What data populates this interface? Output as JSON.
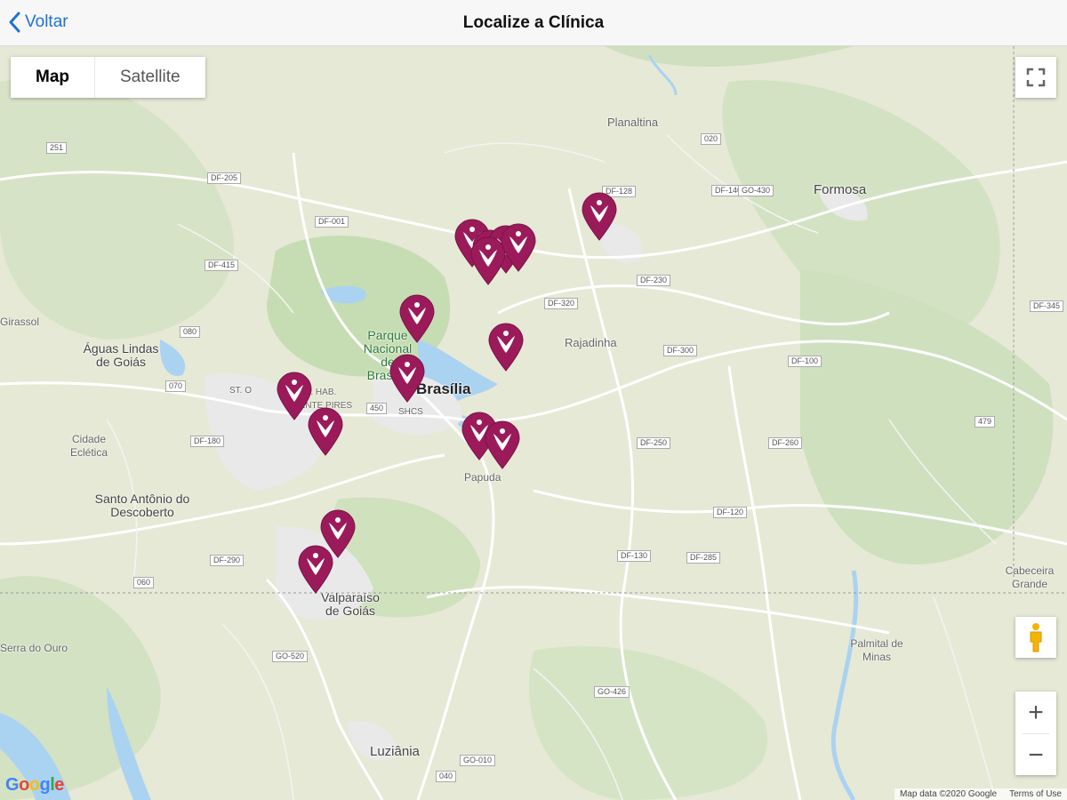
{
  "nav": {
    "back_label": "Voltar",
    "title": "Localize a Clínica"
  },
  "map": {
    "type_buttons": [
      "Map",
      "Satellite"
    ],
    "selected_type": "Map",
    "attribution": "Map data ©2020 Google",
    "terms": "Terms of Use",
    "logo": "Google",
    "zoom_in": "+",
    "zoom_out": "−",
    "marker_color": "#9b1b5a"
  },
  "places": [
    "Planaltina",
    "Formosa",
    "Águas Lindas de Goiás",
    "Parque Nacional de Brasília",
    "Brasília",
    "Rajadinha",
    "Cidade Eclética",
    "Santo Antônio do Descoberto",
    "Papuda",
    "Valparaíso de Goiás",
    "Luziânia",
    "Cabeceira Grande",
    "Palmital de Minas",
    "Serra do Ouro",
    "Girassol",
    "ST. HAB. VICENTE PIRES",
    "SHCS",
    "ST. O"
  ],
  "road_labels": [
    "DF-205",
    "DF-001",
    "DF-415",
    "DF-128",
    "DF-345",
    "DF-100",
    "DF-180",
    "DF-290",
    "DF-130",
    "DF-285",
    "GO-426",
    "GO-520",
    "GO-010",
    "251",
    "479",
    "020",
    "450",
    "040",
    "070",
    "080",
    "060",
    "DF-250",
    "DF-230",
    "DF-140",
    "GO-430",
    "DF-120",
    "DF-300",
    "DF-320",
    "DF-260"
  ],
  "markers_count": 15
}
